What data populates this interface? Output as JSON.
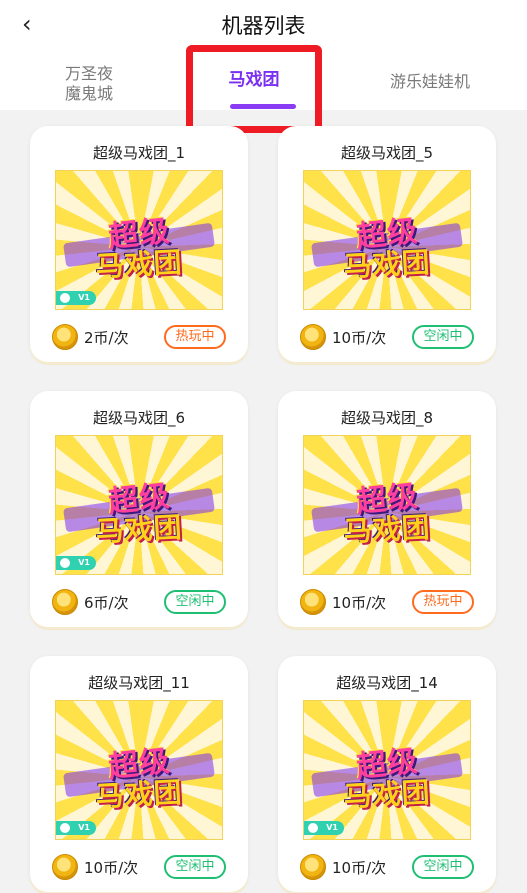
{
  "header": {
    "back_icon": "chevron-left-icon",
    "back_glyph": "‹",
    "title": "机器列表"
  },
  "tabs": [
    {
      "label": "万圣夜\n魔鬼城",
      "active": false
    },
    {
      "label": "马戏团",
      "active": true
    },
    {
      "label": "游乐娃娃机",
      "active": false
    }
  ],
  "colors": {
    "active_tab": "#7b2ff2",
    "highlight_box": "#ee1b24",
    "status_hot": "#ff6a1c",
    "status_idle": "#1fbf73"
  },
  "machines": [
    {
      "name": "超级马戏团_1",
      "price": "2币/次",
      "status": "热玩中",
      "status_type": "hot"
    },
    {
      "name": "超级马戏团_5",
      "price": "10币/次",
      "status": "空闲中",
      "status_type": "idle"
    },
    {
      "name": "超级马戏团_6",
      "price": "6币/次",
      "status": "空闲中",
      "status_type": "idle"
    },
    {
      "name": "超级马戏团_8",
      "price": "10币/次",
      "status": "热玩中",
      "status_type": "hot"
    },
    {
      "name": "超级马戏团_11",
      "price": "10币/次",
      "status": "空闲中",
      "status_type": "idle"
    },
    {
      "name": "超级马戏团_14",
      "price": "10币/次",
      "status": "空闲中",
      "status_type": "idle"
    }
  ],
  "game_logo": {
    "line1": "超级",
    "line2": "马戏团"
  },
  "vip_badge": "V1"
}
